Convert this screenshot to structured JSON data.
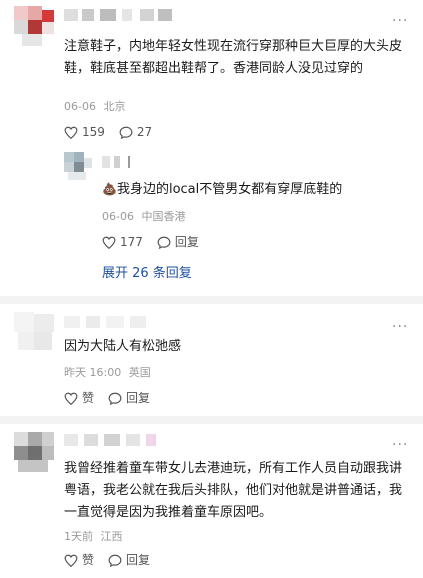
{
  "comments": [
    {
      "text": "注意鞋子，内地年轻女性现在流行穿那种巨大巨厚的大头皮鞋，鞋底甚至都超出鞋帮了。香港同龄人没见过穿的",
      "date": "06-06",
      "location": "北京",
      "likes": "159",
      "replies": "27",
      "reply": {
        "emoji": "💩",
        "text": "我身边的local不管男女都有穿厚底鞋的",
        "date": "06-06",
        "location": "中国香港",
        "likes": "177",
        "reply_label": "回复"
      },
      "expand_label": "展开 26 条回复"
    },
    {
      "text": "因为大陆人有松弛感",
      "date": "昨天 16:00",
      "location": "英国",
      "like_label": "赞",
      "reply_label": "回复"
    },
    {
      "text": "我曾经推着童车带女儿去港迪玩，所有工作人员自动跟我讲粤语，我老公就在我后头排队，他们对他就是讲普通话，我一直觉得是因为我推着童车原因吧。",
      "date": "1天前",
      "location": "江西",
      "like_label": "赞",
      "reply_label": "回复"
    }
  ],
  "more_label": "···",
  "colors": {
    "link": "#1e4f9c",
    "meta": "#9a9a9a",
    "text": "#1a1a1a"
  }
}
